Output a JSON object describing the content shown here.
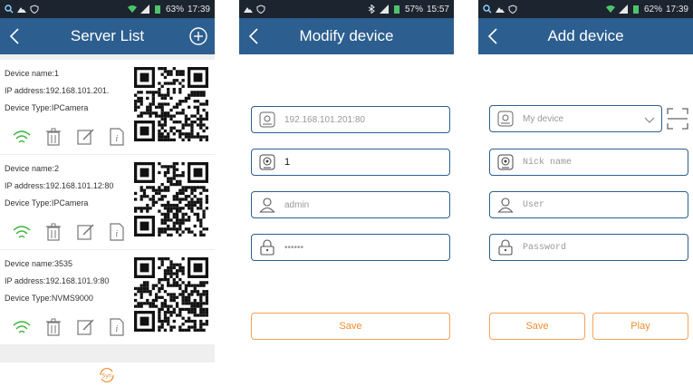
{
  "screens": {
    "server_list": {
      "status": {
        "battery": "63%",
        "time": "17:39"
      },
      "title": "Server List",
      "devices": [
        {
          "name": "Device name:1",
          "ip": "IP address:192.168.101.201.",
          "type": "Device Type:IPCamera"
        },
        {
          "name": "Device name:2",
          "ip": "IP address:192.168.101.12:80",
          "type": "Device Type:IPCamera"
        },
        {
          "name": "Device name:3535",
          "ip": "IP address:192.168.101.9:80",
          "type": "Device Type:NVMS9000"
        }
      ],
      "sync_label": "Syn"
    },
    "modify_device": {
      "status": {
        "battery": "57%",
        "time": "15:57"
      },
      "title": "Modify device",
      "address_placeholder": "192.168.101.201:80",
      "nickname_value": "1",
      "user_placeholder": "admin",
      "password_masked": "••••••",
      "save_label": "Save"
    },
    "add_device": {
      "status": {
        "battery": "62%",
        "time": "17:39"
      },
      "title": "Add device",
      "device_select": "My device",
      "nickname_placeholder": "Nick name",
      "user_placeholder": "User",
      "password_placeholder": "Password",
      "save_label": "Save",
      "play_label": "Play"
    }
  },
  "colors": {
    "titlebar": "#2c5f8f",
    "accent_orange": "#f08c33",
    "wifi_green": "#3cb43c",
    "statusbar": "#1c2430"
  }
}
